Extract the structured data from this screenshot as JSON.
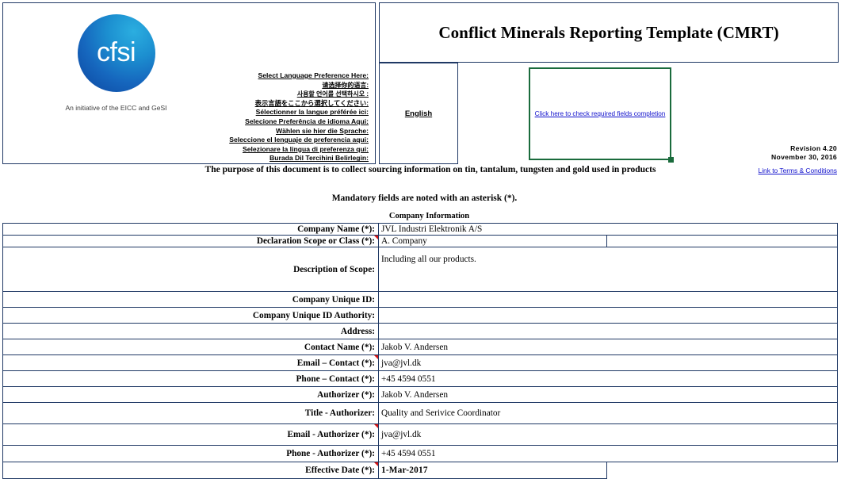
{
  "header": {
    "title": "Conflict Minerals Reporting Template (CMRT)",
    "logo_text": "cfsi",
    "logo_subtitle": "An initiative of the EICC and GeSI",
    "language_prompts": [
      "Select Language Preference Here:",
      "请选择你的语言:",
      "사용할 언어를 선택하시오 :",
      "表示言語をここから選択してください:",
      "Sélectionner la langue préférée ici:",
      "Selecione Preferência de idioma Aqui:",
      "Wählen sie hier die Sprache:",
      "Seleccione el lenguaje de preferencia aqui:",
      "Selezionare la lingua di preferenza qui:",
      "Burada Dil Tercihini Belirlegin:"
    ],
    "selected_language": "English",
    "check_fields_link": "Click here to check required fields completion",
    "revision": "Revision 4.20",
    "revision_date": "November 30, 2016",
    "terms_link": "Link to Terms & Conditions",
    "purpose": "The purpose of this document is to collect sourcing information on tin, tantalum, tungsten and gold used in products",
    "accent_green": "#1A6B3C",
    "accent_navy": "#1F3864",
    "link_blue": "#1111CC"
  },
  "notice": {
    "mandatory": "Mandatory fields are noted with an asterisk (*).",
    "section_title": "Company Information"
  },
  "company_information": {
    "rows": [
      {
        "label": "Company Name (*):",
        "value": "JVL Industri Elektronik A/S",
        "comment": false
      },
      {
        "label": "Declaration Scope or Class (*):",
        "value": "A. Company",
        "comment": true
      },
      {
        "label": "Description of Scope:",
        "value": "Including all our products.",
        "comment": false
      },
      {
        "label": "Company Unique ID:",
        "value": "",
        "comment": false
      },
      {
        "label": "Company Unique ID Authority:",
        "value": "",
        "comment": false
      },
      {
        "label": "Address:",
        "value": "",
        "comment": false
      },
      {
        "label": "Contact Name (*):",
        "value": "Jakob V. Andersen",
        "comment": false
      },
      {
        "label": "Email – Contact (*):",
        "value": "jva@jvl.dk",
        "comment": true
      },
      {
        "label": "Phone – Contact (*):",
        "value": "+45 4594 0551",
        "comment": false
      },
      {
        "label": "Authorizer (*):",
        "value": "Jakob V. Andersen",
        "comment": false
      },
      {
        "label": "Title - Authorizer:",
        "value": "Quality and Serivice Coordinator",
        "comment": false
      },
      {
        "label": "Email - Authorizer (*):",
        "value": "jva@jvl.dk",
        "comment": true
      },
      {
        "label": "Phone - Authorizer (*):",
        "value": "+45 4594 0551",
        "comment": false
      },
      {
        "label": "Effective Date (*):",
        "value": "1-Mar-2017",
        "comment": true
      }
    ]
  }
}
